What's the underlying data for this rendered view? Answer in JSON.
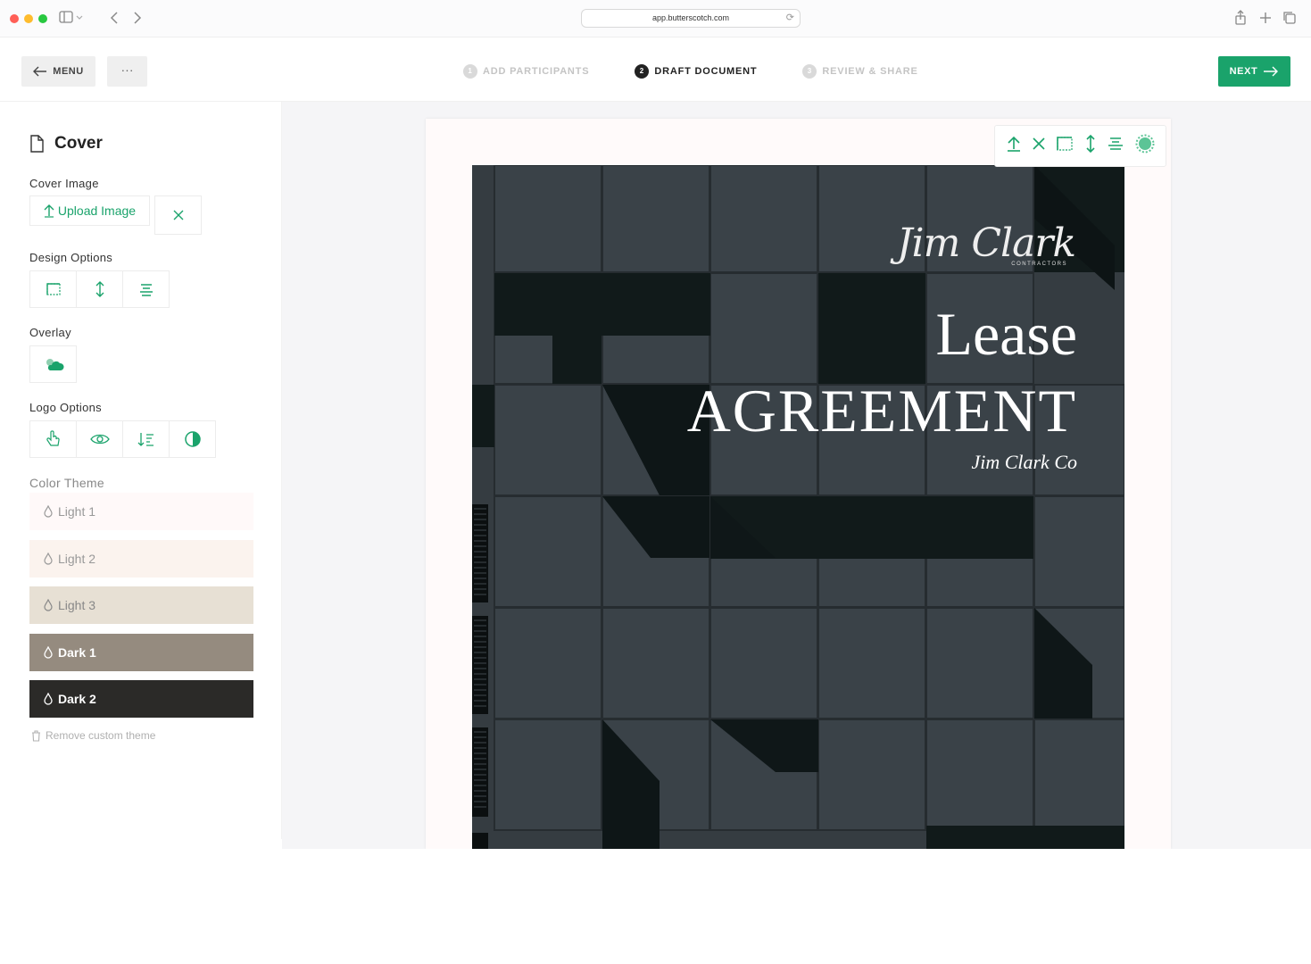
{
  "browser": {
    "url": "app.butterscotch.com",
    "traffic_colors": [
      "#ff5f57",
      "#febc2e",
      "#28c840"
    ]
  },
  "header": {
    "menu_label": "MENU",
    "more_label": "···",
    "steps": [
      {
        "num": "1",
        "label": "ADD PARTICIPANTS",
        "active": false
      },
      {
        "num": "2",
        "label": "DRAFT DOCUMENT",
        "active": true
      },
      {
        "num": "3",
        "label": "REVIEW & SHARE",
        "active": false
      }
    ],
    "next_label": "NEXT",
    "accent": "#1aa36b"
  },
  "sidebar": {
    "title": "Cover",
    "cover_image_label": "Cover Image",
    "upload_label": "Upload Image",
    "design_options_label": "Design Options",
    "overlay_label": "Overlay",
    "logo_options_label": "Logo Options",
    "color_theme_label": "Color Theme",
    "themes": [
      {
        "label": "Light 1",
        "bg": "#fff9f9",
        "fg": "#999999"
      },
      {
        "label": "Light 2",
        "bg": "#fbf3ee",
        "fg": "#999999"
      },
      {
        "label": "Light 3",
        "bg": "#e7e0d4",
        "fg": "#888888"
      },
      {
        "label": "Dark 1",
        "bg": "#958b7f",
        "fg": "#ffffff"
      },
      {
        "label": "Dark 2",
        "bg": "#2b2a28",
        "fg": "#ffffff"
      }
    ],
    "remove_theme_label": "Remove custom theme"
  },
  "document": {
    "logo_script": "Jim Clark",
    "logo_sub": "CONTRACTORS",
    "title_line1": "Lease",
    "title_line2": "AGREEMENT",
    "subtitle": "Jim Clark Co"
  }
}
